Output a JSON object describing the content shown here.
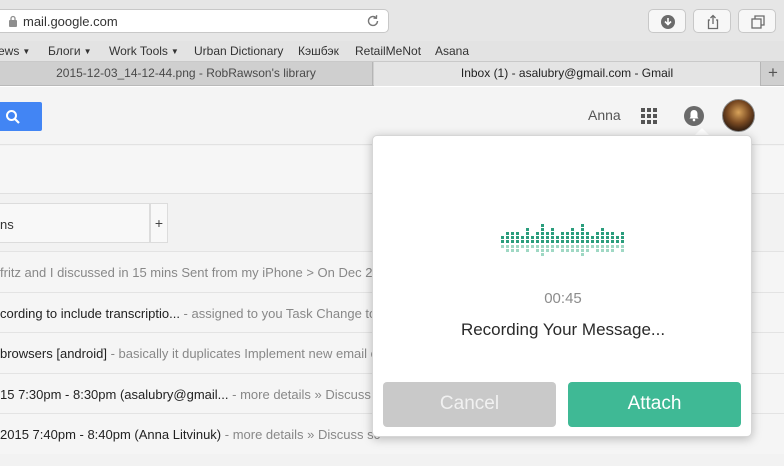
{
  "browser": {
    "url": "mail.google.com",
    "bookmarks": [
      {
        "label": "ews",
        "has_menu": true
      },
      {
        "label": "Блоги",
        "has_menu": true
      },
      {
        "label": "Work Tools",
        "has_menu": true
      },
      {
        "label": "Urban Dictionary",
        "has_menu": false
      },
      {
        "label": "Кэшбэк",
        "has_menu": false
      },
      {
        "label": "RetailMeNot",
        "has_menu": false
      },
      {
        "label": "Asana",
        "has_menu": false
      }
    ],
    "tabs": [
      {
        "label": "2015-12-03_14-12-44.png - RobRawson's library",
        "active": false
      },
      {
        "label": "Inbox (1) - asalubry@gmail.com - Gmail",
        "active": true
      }
    ],
    "new_tab_symbol": "+"
  },
  "gmail": {
    "user_name": "Anna",
    "category_tab": "ns",
    "category_add": "+",
    "rows": [
      {
        "text": "",
        "snippet": " fritz and I discussed in 15 mins Sent from my iPhone > On Dec 2"
      },
      {
        "text": "cording to include transcriptio...",
        "snippet": " - assigned to you Task Change to"
      },
      {
        "text": "browsers [android]",
        "snippet": " - basically it duplicates Implement new email o"
      },
      {
        "text": "15 7:30pm - 8:30pm (asalubry@gmail...",
        "snippet": " - more details » Discuss S"
      },
      {
        "text": "2015 7:40pm - 8:40pm (Anna Litvinuk)",
        "snippet": " - more details » Discuss sc"
      }
    ]
  },
  "recorder": {
    "timer": "00:45",
    "status": "Recording Your Message...",
    "cancel_label": "Cancel",
    "attach_label": "Attach",
    "wave_levels": [
      2,
      3,
      3,
      3,
      2,
      4,
      2,
      3,
      5,
      3,
      4,
      2,
      3,
      3,
      4,
      3,
      5,
      3,
      2,
      3,
      4,
      3,
      3,
      2,
      3
    ],
    "colors": {
      "attach": "#3fb995",
      "cancel": "#c9c9c9",
      "wave_dark": "#2a9d7c",
      "wave_light": "#9fd8c4"
    }
  }
}
